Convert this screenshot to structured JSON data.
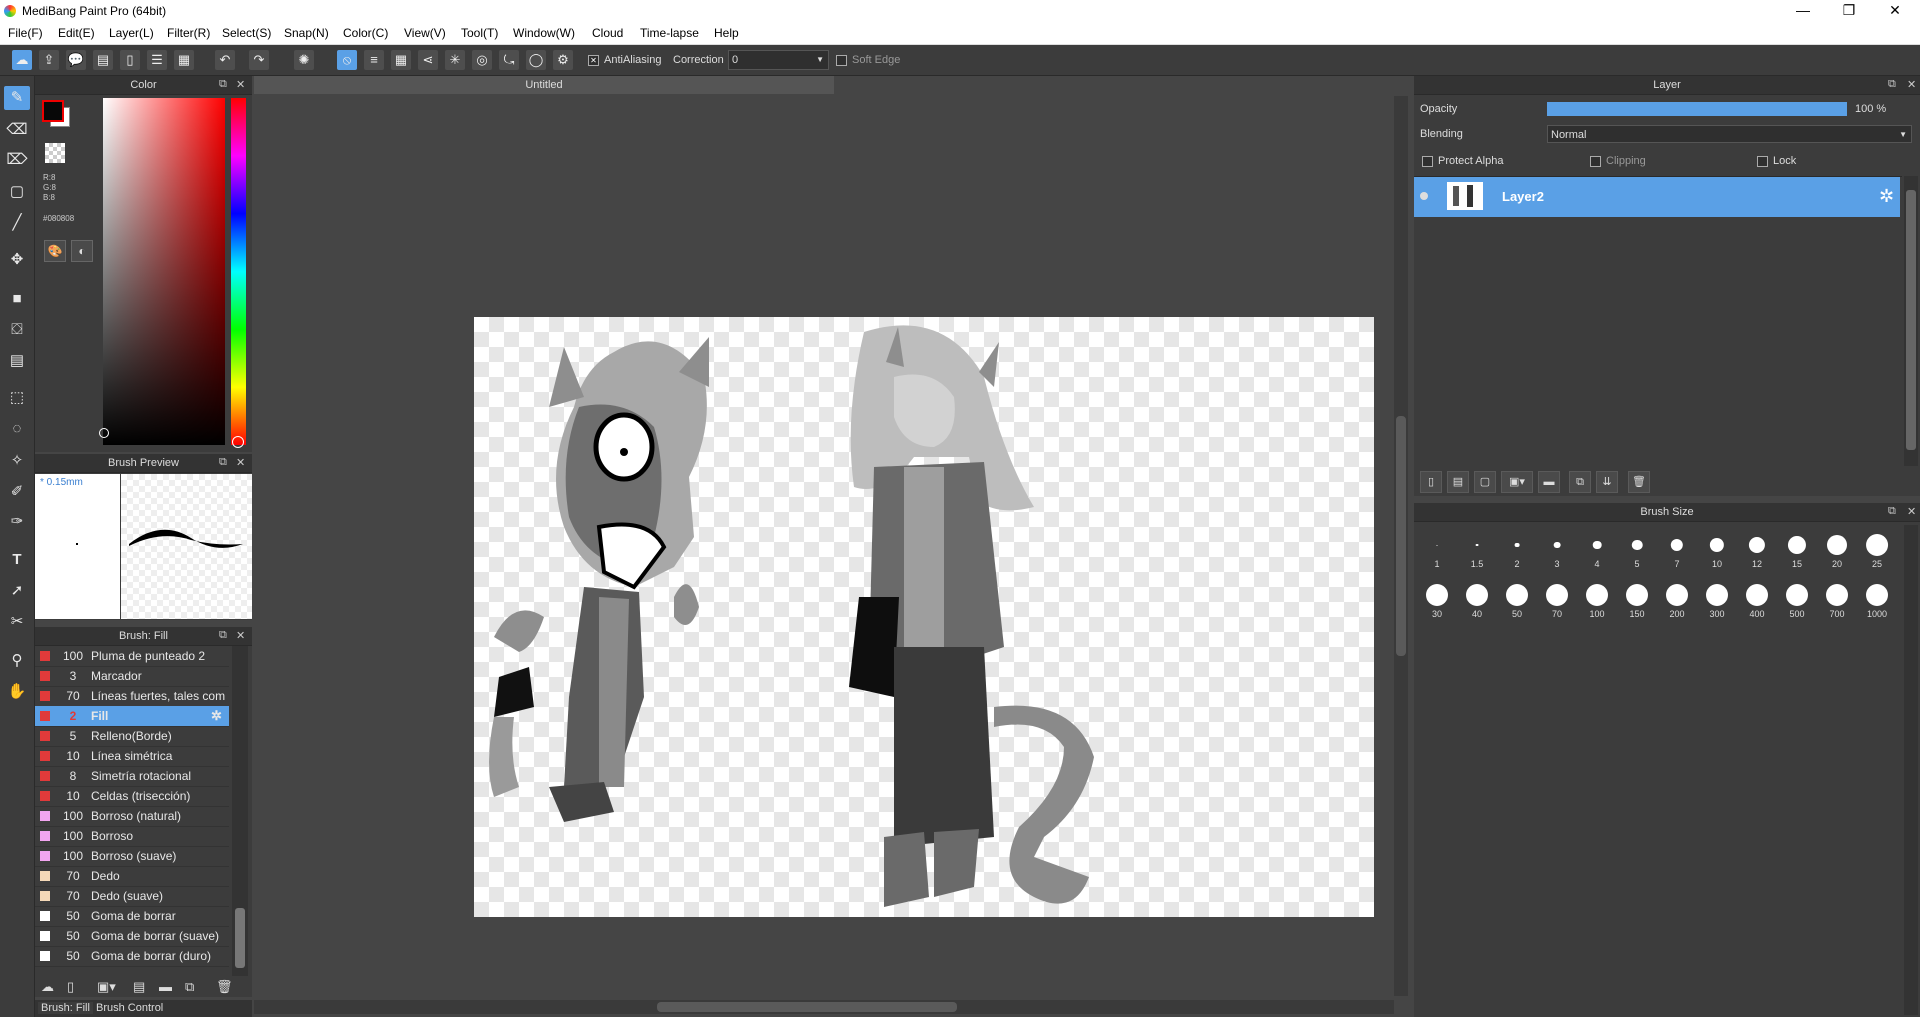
{
  "app": {
    "title": "MediBang Paint Pro (64bit)"
  },
  "window_buttons": {
    "minimize": "—",
    "maximize": "❐",
    "close": "✕"
  },
  "menu": [
    "File(F)",
    "Edit(E)",
    "Layer(L)",
    "Filter(R)",
    "Select(S)",
    "Snap(N)",
    "Color(C)",
    "View(V)",
    "Tool(T)",
    "Window(W)",
    "Cloud",
    "Time-lapse",
    "Help"
  ],
  "toolbar": {
    "antialiasing_label": "AntiAliasing",
    "antialiasing_checked": true,
    "correction_label": "Correction",
    "correction_value": "0",
    "soft_edge_label": "Soft Edge"
  },
  "color_panel": {
    "title": "Color",
    "rgb": {
      "r": "R:8",
      "g": "G:8",
      "b": "B:8"
    },
    "hex": "#080808",
    "primary_color": "#080808",
    "secondary_color": "#ffffff"
  },
  "brush_preview": {
    "title": "Brush Preview",
    "size": "* 0.15mm"
  },
  "brush_list": {
    "title": "Brush: Fill",
    "items": [
      {
        "size": "100",
        "name": "Pluma de punteado 2",
        "color": "#e03a3a"
      },
      {
        "size": "3",
        "name": "Marcador",
        "color": "#e03a3a"
      },
      {
        "size": "70",
        "name": "Líneas fuertes, tales com",
        "color": "#e03a3a"
      },
      {
        "size": "2",
        "name": "Fill",
        "color": "#e03a3a",
        "selected": true
      },
      {
        "size": "5",
        "name": "Relleno(Borde)",
        "color": "#e03a3a"
      },
      {
        "size": "10",
        "name": "Línea simétrica",
        "color": "#e03a3a"
      },
      {
        "size": "8",
        "name": "Simetría rotacional",
        "color": "#e03a3a"
      },
      {
        "size": "10",
        "name": "Celdas (trisección)",
        "color": "#e03a3a"
      },
      {
        "size": "100",
        "name": "Borroso (natural)",
        "color": "#f2a6f0"
      },
      {
        "size": "100",
        "name": "Borroso",
        "color": "#f2a6f0"
      },
      {
        "size": "100",
        "name": "Borroso (suave)",
        "color": "#f2a6f0"
      },
      {
        "size": "70",
        "name": "Dedo",
        "color": "#f5d9b8"
      },
      {
        "size": "70",
        "name": "Dedo (suave)",
        "color": "#f5d9b8"
      },
      {
        "size": "50",
        "name": "Goma de borrar",
        "color": "#ffffff"
      },
      {
        "size": "50",
        "name": "Goma de borrar (suave)",
        "color": "#ffffff"
      },
      {
        "size": "50",
        "name": "Goma de borrar (duro)",
        "color": "#ffffff"
      }
    ],
    "bottom_tabs": [
      "Brush: Fill",
      "Brush Control"
    ]
  },
  "document": {
    "tab_title": "Untitled"
  },
  "layer_panel": {
    "title": "Layer",
    "opacity_label": "Opacity",
    "opacity_value": "100 %",
    "opacity_fraction": 1.0,
    "blending_label": "Blending",
    "blending_value": "Normal",
    "protect_alpha_label": "Protect Alpha",
    "clipping_label": "Clipping",
    "lock_label": "Lock",
    "layers": [
      {
        "name": "Layer2",
        "selected": true
      }
    ]
  },
  "brush_size_panel": {
    "title": "Brush Size",
    "sizes_row1": [
      "1",
      "1.5",
      "2",
      "3",
      "4",
      "5",
      "7",
      "10",
      "12",
      "15",
      "20",
      "25"
    ],
    "sizes_row2": [
      "30",
      "40",
      "50",
      "70",
      "100",
      "150",
      "200",
      "300",
      "400",
      "500",
      "700",
      "1000"
    ]
  },
  "colors": {
    "accent": "#5aa0e6",
    "panel": "#3c3c3c",
    "canvas_bg": "#454545"
  }
}
